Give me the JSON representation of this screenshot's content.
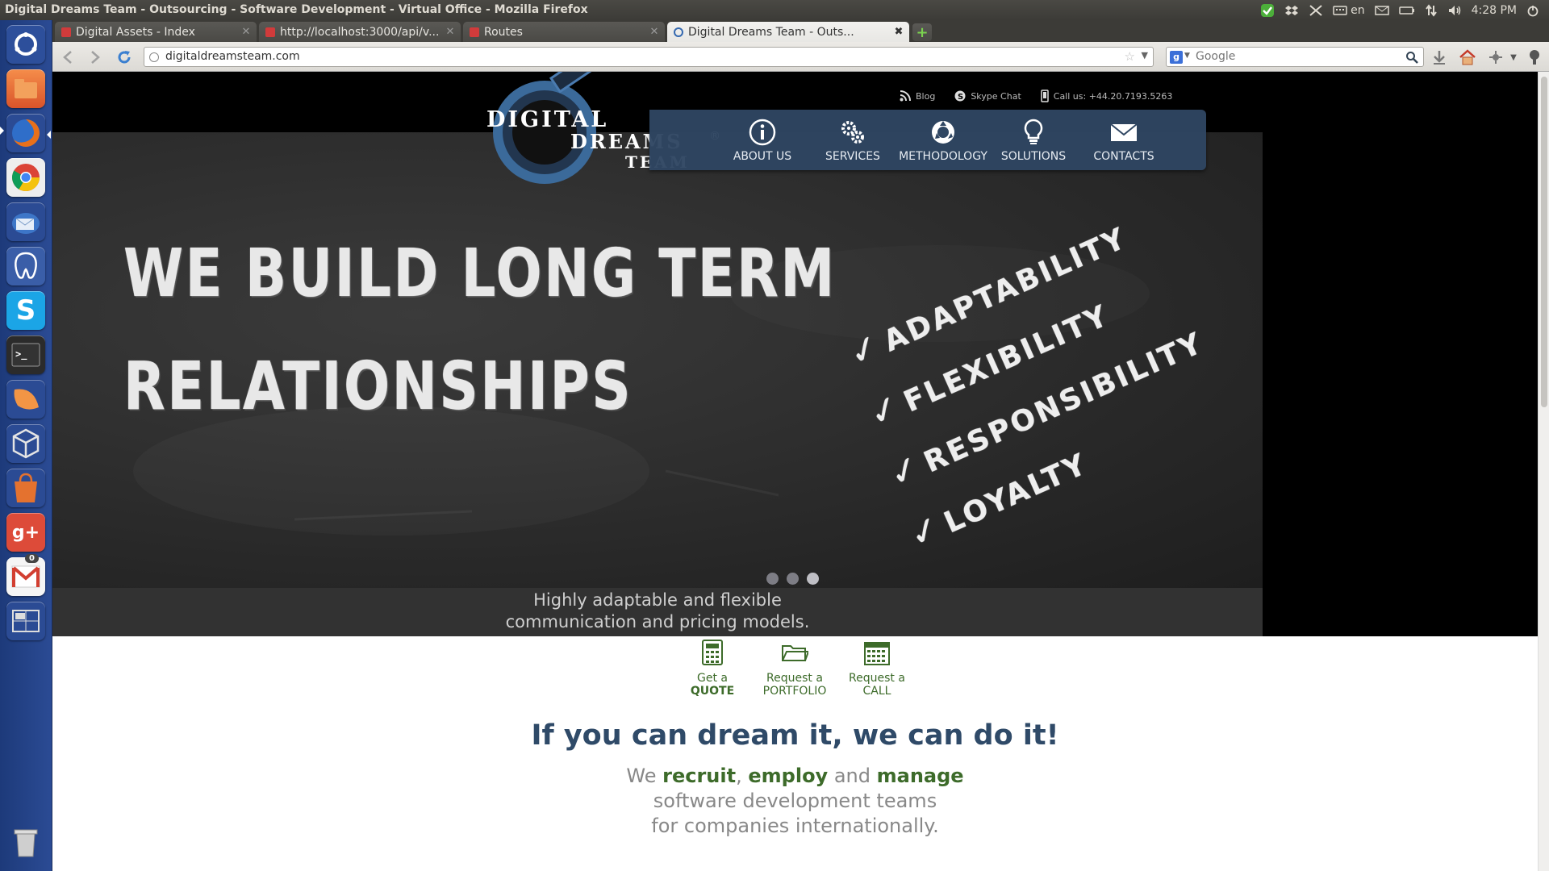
{
  "os_panel": {
    "window_title": "Digital Dreams Team - Outsourcing - Software Development - Virtual Office - Mozilla Firefox",
    "keyboard_layout": "en",
    "clock": "4:28 PM"
  },
  "launcher": {
    "items": [
      "Ubuntu dash",
      "Files",
      "Firefox",
      "Chrome",
      "Thunderbird",
      "pgAdmin",
      "Skype",
      "Terminal",
      "Orange app",
      "VirtualBox",
      "Software Center",
      "Google Plus",
      "Gmail",
      "Workspaces",
      "Trash"
    ],
    "gmail_badge": "0"
  },
  "browser": {
    "tabs": [
      {
        "label": "Digital Assets - Index"
      },
      {
        "label": "http://localhost:3000/api/v..."
      },
      {
        "label": "Routes"
      },
      {
        "label": "Digital Dreams Team - Outs..."
      }
    ],
    "new_tab": "+",
    "url": "digitaldreamsteam.com",
    "search_placeholder": "Google"
  },
  "site": {
    "logo": {
      "line1": "DIGITAL",
      "line2": "DREAMS",
      "registered": "®",
      "line3": "TEAM"
    },
    "top_links": {
      "blog": "Blog",
      "skype": "Skype Chat",
      "phone": "Call us: +44.20.7193.5263"
    },
    "nav": [
      {
        "label": "ABOUT US",
        "icon": "info-icon"
      },
      {
        "label": "SERVICES",
        "icon": "gears-icon"
      },
      {
        "label": "METHODOLOGY",
        "icon": "cycle-icon"
      },
      {
        "label": "SOLUTIONS",
        "icon": "lightbulb-icon"
      },
      {
        "label": "CONTACTS",
        "icon": "envelope-icon"
      }
    ],
    "hero": {
      "line1": "WE BUILD LONG TERM",
      "line2": "RELATIONSHIPS",
      "values": [
        "ADAPTABILITY",
        "FLEXIBILITY",
        "RESPONSIBILITY",
        "LOYALTY"
      ],
      "slides": 3,
      "active_slide": 3,
      "caption_line1": "Highly adaptable and flexible",
      "caption_line2": "communication and pricing models."
    },
    "cta": [
      {
        "top": "Get a",
        "bottom": "QUOTE",
        "icon": "calculator-icon"
      },
      {
        "top": "Request a",
        "bottom": "PORTFOLIO",
        "icon": "folder-icon"
      },
      {
        "top": "Request a",
        "bottom": "CALL",
        "icon": "calendar-icon"
      }
    ],
    "headline": "If you can dream it, we can do it!",
    "tagline": {
      "we": "We",
      "recruit": "recruit",
      "comma": ",",
      "employ": "employ",
      "and": "and",
      "manage": "manage",
      "line2": "software development teams",
      "line3": "for companies internationally."
    }
  },
  "colors": {
    "nav_bg": "#2f4662",
    "brand_green": "#3d6b2a",
    "headline_blue": "#2f4a68",
    "launcher_blue": "#2b4b94"
  }
}
